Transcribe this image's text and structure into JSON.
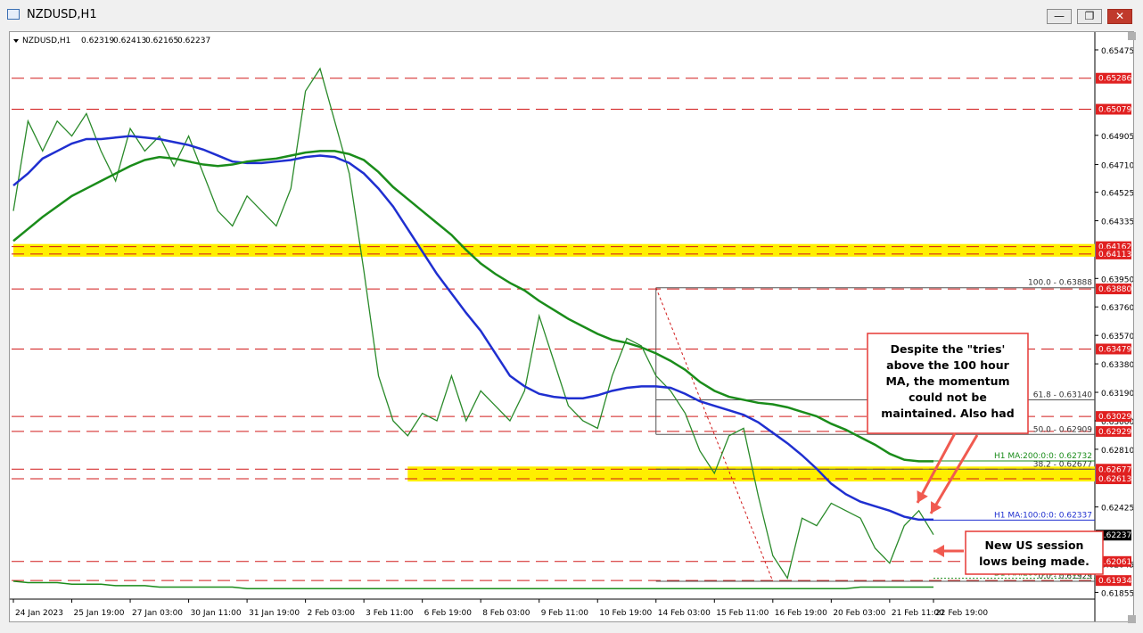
{
  "window": {
    "title": "NZDUSD,H1",
    "buttons": {
      "minimize": "—",
      "restore": "❐",
      "close": "✕"
    }
  },
  "chart_data": {
    "type": "line",
    "symbol_header": "NZDUSD,H1",
    "ohlc": [
      "0.62319",
      "0.62413",
      "0.62165",
      "0.62237"
    ],
    "ylim": [
      0.6181,
      0.6557
    ],
    "y_ticks": [
      0.65475,
      0.64905,
      0.6471,
      0.64525,
      0.64335,
      0.6395,
      0.6376,
      0.6357,
      0.6338,
      0.6319,
      0.63,
      0.6281,
      0.62425,
      0.62045,
      0.61855
    ],
    "x_labels": [
      {
        "label": "24 Jan 2023",
        "idx": 0
      },
      {
        "label": "25 Jan 19:00",
        "idx": 4
      },
      {
        "label": "27 Jan 03:00",
        "idx": 8
      },
      {
        "label": "30 Jan 11:00",
        "idx": 12
      },
      {
        "label": "31 Jan 19:00",
        "idx": 16
      },
      {
        "label": "2 Feb 03:00",
        "idx": 20
      },
      {
        "label": "3 Feb 11:00",
        "idx": 24
      },
      {
        "label": "6 Feb 19:00",
        "idx": 28
      },
      {
        "label": "8 Feb 03:00",
        "idx": 32
      },
      {
        "label": "9 Feb 11:00",
        "idx": 36
      },
      {
        "label": "10 Feb 19:00",
        "idx": 40
      },
      {
        "label": "14 Feb 03:00",
        "idx": 44
      },
      {
        "label": "15 Feb 11:00",
        "idx": 48
      },
      {
        "label": "16 Feb 19:00",
        "idx": 52
      },
      {
        "label": "20 Feb 03:00",
        "idx": 56
      },
      {
        "label": "21 Feb 11:00",
        "idx": 60
      },
      {
        "label": "22 Feb 19:00",
        "idx": 63
      }
    ],
    "n_slots": 64,
    "current_price": 0.62237,
    "price_line": [
      0.644,
      0.65,
      0.648,
      0.65,
      0.649,
      0.6505,
      0.648,
      0.646,
      0.6495,
      0.648,
      0.649,
      0.647,
      0.649,
      0.6465,
      0.644,
      0.643,
      0.645,
      0.644,
      0.643,
      0.6455,
      0.652,
      0.6535,
      0.65,
      0.6465,
      0.64,
      0.633,
      0.63,
      0.629,
      0.6305,
      0.63,
      0.633,
      0.63,
      0.632,
      0.631,
      0.63,
      0.632,
      0.637,
      0.634,
      0.631,
      0.63,
      0.6295,
      0.633,
      0.6355,
      0.635,
      0.633,
      0.632,
      0.6305,
      0.628,
      0.6265,
      0.629,
      0.6295,
      0.625,
      0.621,
      0.6195,
      0.6235,
      0.623,
      0.6245,
      0.624,
      0.6235,
      0.6215,
      0.6205,
      0.623,
      0.624,
      0.6224
    ],
    "series": [
      {
        "name": "H1 MA:100:0:0",
        "color": "#1f2fd0",
        "values": [
          0.6457,
          0.6465,
          0.6475,
          0.648,
          0.6485,
          0.6488,
          0.6488,
          0.6489,
          0.649,
          0.6489,
          0.6488,
          0.6486,
          0.6484,
          0.6481,
          0.6477,
          0.6473,
          0.6472,
          0.6472,
          0.6473,
          0.6474,
          0.6476,
          0.6477,
          0.6476,
          0.6472,
          0.6465,
          0.6455,
          0.6443,
          0.6428,
          0.6413,
          0.6398,
          0.6385,
          0.6372,
          0.636,
          0.6345,
          0.633,
          0.6323,
          0.6318,
          0.6316,
          0.6315,
          0.6315,
          0.6317,
          0.632,
          0.6322,
          0.6323,
          0.6323,
          0.6322,
          0.6318,
          0.6313,
          0.631,
          0.6307,
          0.6304,
          0.6299,
          0.6292,
          0.6285,
          0.6277,
          0.6268,
          0.6258,
          0.6251,
          0.6246,
          0.6243,
          0.624,
          0.6236,
          0.6234,
          0.6234
        ]
      },
      {
        "name": "H1 MA:200:0:0",
        "color": "#1a8c1a",
        "values": [
          0.642,
          0.6428,
          0.6436,
          0.6443,
          0.645,
          0.6455,
          0.646,
          0.6465,
          0.647,
          0.6474,
          0.6476,
          0.6475,
          0.6473,
          0.6471,
          0.647,
          0.6471,
          0.6473,
          0.6474,
          0.6475,
          0.6477,
          0.6479,
          0.648,
          0.648,
          0.6478,
          0.6474,
          0.6466,
          0.6456,
          0.6448,
          0.644,
          0.6432,
          0.6424,
          0.6414,
          0.6405,
          0.6398,
          0.6392,
          0.6387,
          0.638,
          0.6374,
          0.6368,
          0.6363,
          0.6358,
          0.6354,
          0.6352,
          0.6349,
          0.6345,
          0.634,
          0.6334,
          0.6326,
          0.632,
          0.6316,
          0.6314,
          0.6312,
          0.6311,
          0.6309,
          0.6306,
          0.6303,
          0.6298,
          0.6294,
          0.6289,
          0.6284,
          0.6278,
          0.6274,
          0.6273,
          0.6273
        ]
      },
      {
        "name": "D1 MA:200:0:0",
        "color": "#1a8c1a",
        "values": [
          0.6193,
          0.6192,
          0.6192,
          0.6192,
          0.6191,
          0.6191,
          0.6191,
          0.619,
          0.619,
          0.619,
          0.6189,
          0.6189,
          0.6189,
          0.6189,
          0.6189,
          0.6189,
          0.6188,
          0.6188,
          0.6188,
          0.6188,
          0.6188,
          0.6188,
          0.6188,
          0.6188,
          0.6188,
          0.6188,
          0.6188,
          0.6188,
          0.6188,
          0.6188,
          0.6188,
          0.6188,
          0.6188,
          0.6188,
          0.6188,
          0.6188,
          0.6188,
          0.6188,
          0.6188,
          0.6188,
          0.6188,
          0.6188,
          0.6188,
          0.6188,
          0.6188,
          0.6188,
          0.6188,
          0.6188,
          0.6188,
          0.6188,
          0.6188,
          0.6188,
          0.6188,
          0.6188,
          0.6188,
          0.6188,
          0.6188,
          0.6188,
          0.6189,
          0.6189,
          0.6189,
          0.6189,
          0.6189,
          0.6189
        ]
      }
    ],
    "ma_labels": [
      {
        "text": "H1 MA:200:0:0: 0.62732",
        "value": 0.62732
      },
      {
        "text": "H1 MA:100:0:0: 0.62337",
        "value": 0.62337
      },
      {
        "text": "D1 MA:200:0:0: 0.61949",
        "value": 0.61949
      }
    ],
    "red_levels": [
      {
        "value": 0.65286,
        "label": "0.65286"
      },
      {
        "value": 0.65079,
        "label": "0.65079"
      },
      {
        "value": 0.64162,
        "label": "0.64162"
      },
      {
        "value": 0.64113,
        "label": "0.64113"
      },
      {
        "value": 0.6388,
        "label": "0.63880"
      },
      {
        "value": 0.63479,
        "label": "0.63479"
      },
      {
        "value": 0.63029,
        "label": "0.63029"
      },
      {
        "value": 0.62929,
        "label": "0.62929"
      },
      {
        "value": 0.62677,
        "label": "0.62677"
      },
      {
        "value": 0.62613,
        "label": "0.62613"
      },
      {
        "value": 0.62061,
        "label": "0.62061"
      },
      {
        "value": 0.61934,
        "label": "0.61934"
      }
    ],
    "yellow_zones": [
      {
        "from": 0.64113,
        "to": 0.64162,
        "start_idx": 0
      },
      {
        "from": 0.62613,
        "to": 0.62677,
        "start_idx": 27
      }
    ],
    "fib": {
      "start_idx": 44,
      "low_idx": 52,
      "levels": [
        {
          "value": 0.63888,
          "text": "100.0 - 0.63888"
        },
        {
          "value": 0.6314,
          "text": "61.8 - 0.63140"
        },
        {
          "value": 0.62909,
          "text": "50.0 - 0.62909"
        },
        {
          "value": 0.62677,
          "text": "38.2 - 0.62677"
        },
        {
          "value": 0.61929,
          "text": "0.0 - 0.61929"
        }
      ]
    },
    "annotations": [
      {
        "text": [
          "Despite the \"tries'",
          "above the 100 hour",
          "MA, the momentum",
          "could not be",
          "maintained. Also had"
        ]
      },
      {
        "text": [
          "New US session",
          "lows being made."
        ]
      }
    ],
    "grid": false,
    "legend": "none"
  }
}
